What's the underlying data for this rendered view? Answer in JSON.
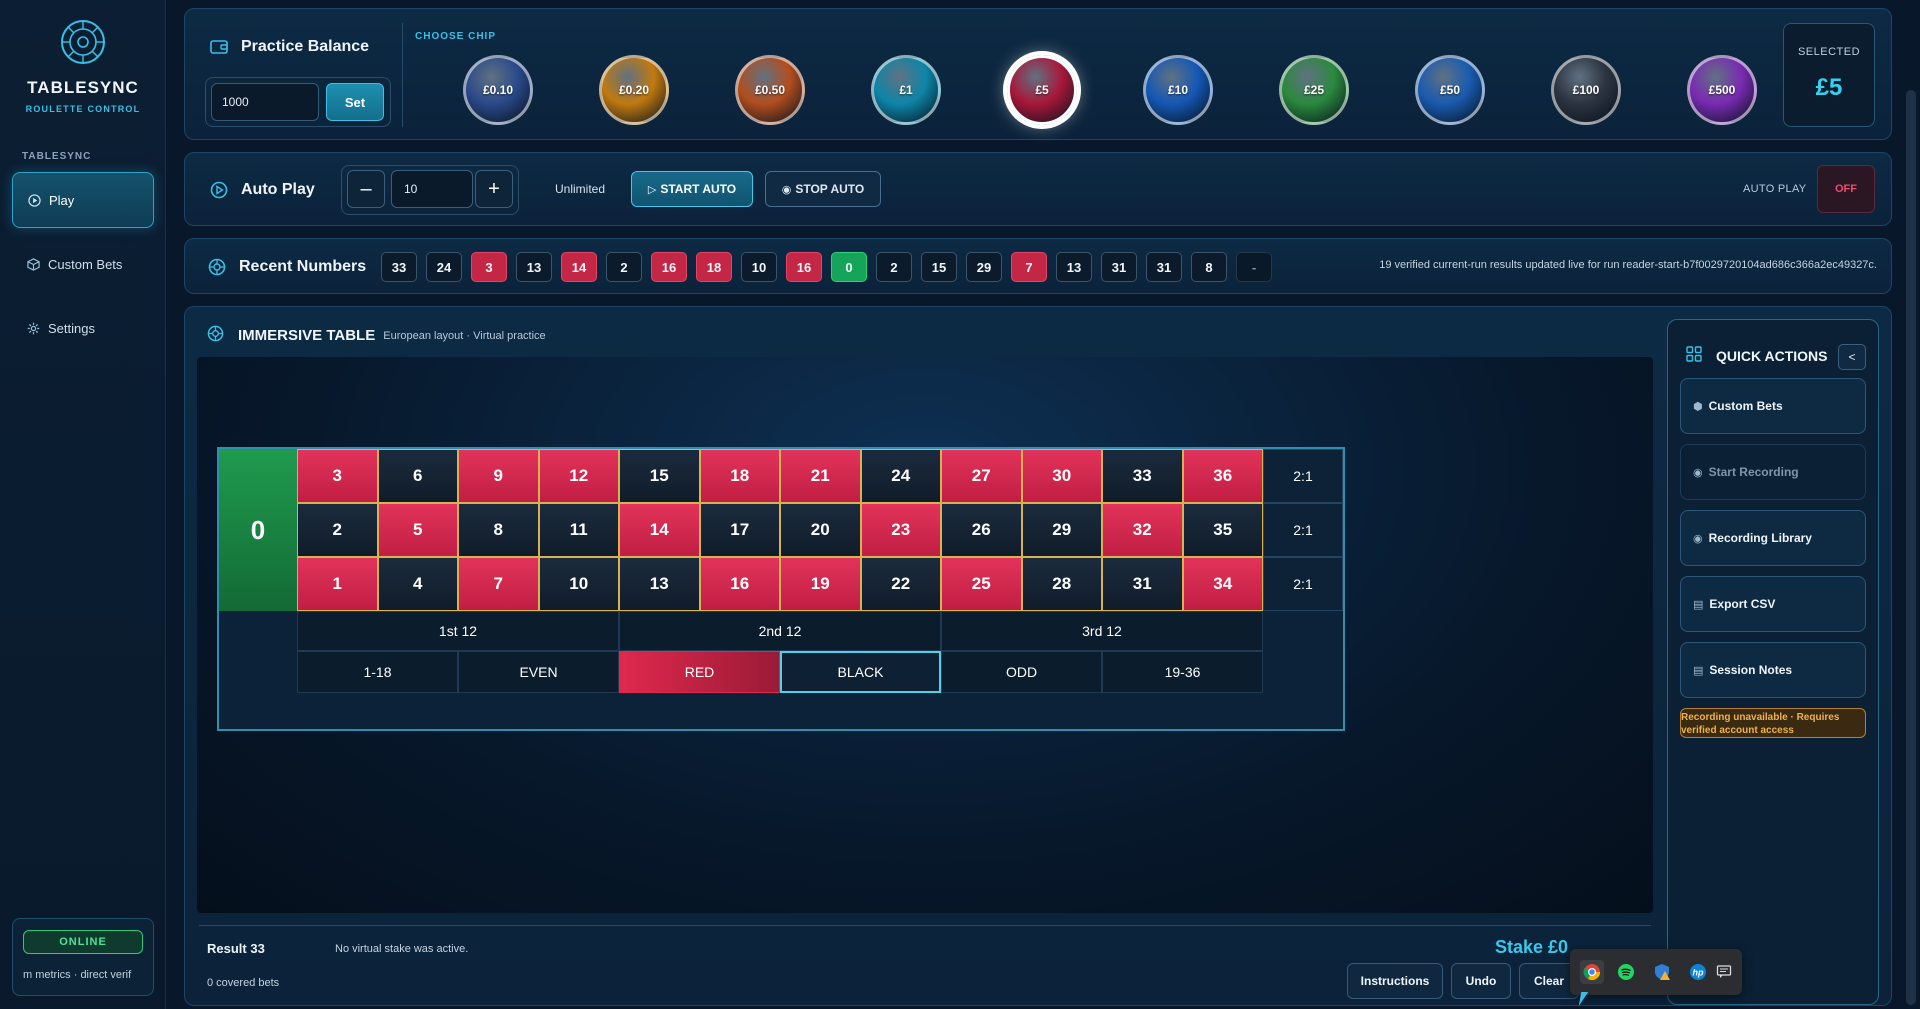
{
  "app": {
    "brand": "TABLESYNC",
    "brand_sub": "ROULETTE CONTROL"
  },
  "sidebar": {
    "section": "TABLESYNC",
    "items": [
      {
        "label": "Play",
        "icon": "play-circle-icon"
      },
      {
        "label": "Custom Bets",
        "icon": "cube-icon"
      },
      {
        "label": "Settings",
        "icon": "gear-icon"
      }
    ],
    "status": {
      "badge": "ONLINE",
      "text": "m metrics · direct verif"
    }
  },
  "balance": {
    "title": "Practice Balance",
    "input_value": "1000",
    "set_label": "Set",
    "choose_chip_label": "CHOOSE CHIP",
    "chips": [
      {
        "label": "£0.10",
        "color": "#2b4a8a"
      },
      {
        "label": "£0.20",
        "color": "#c27a10"
      },
      {
        "label": "£0.50",
        "color": "#b34e1f"
      },
      {
        "label": "£1",
        "color": "#0e86a8"
      },
      {
        "label": "£5",
        "color": "#a8173a"
      },
      {
        "label": "£10",
        "color": "#1558b5"
      },
      {
        "label": "£25",
        "color": "#2b8a3e"
      },
      {
        "label": "£50",
        "color": "#1a5bb0"
      },
      {
        "label": "£100",
        "color": "#2c3440"
      },
      {
        "label": "£500",
        "color": "#7a2bb3"
      }
    ],
    "selected_index": 4,
    "selected_label": "SELECTED",
    "selected_value": "£5"
  },
  "autoplay": {
    "title": "Auto Play",
    "minus": "–",
    "plus": "+",
    "spins_value": "10",
    "unlimited": "Unlimited",
    "start_label": "START AUTO",
    "stop_label": "STOP AUTO",
    "status_label": "AUTO PLAY",
    "status_value": "OFF"
  },
  "recent": {
    "title": "Recent Numbers",
    "numbers": [
      {
        "n": "33",
        "c": "black"
      },
      {
        "n": "24",
        "c": "black"
      },
      {
        "n": "3",
        "c": "red"
      },
      {
        "n": "13",
        "c": "black"
      },
      {
        "n": "14",
        "c": "red"
      },
      {
        "n": "2",
        "c": "black"
      },
      {
        "n": "16",
        "c": "red"
      },
      {
        "n": "18",
        "c": "red"
      },
      {
        "n": "10",
        "c": "black"
      },
      {
        "n": "16",
        "c": "red"
      },
      {
        "n": "0",
        "c": "green"
      },
      {
        "n": "2",
        "c": "black"
      },
      {
        "n": "15",
        "c": "black"
      },
      {
        "n": "29",
        "c": "black"
      },
      {
        "n": "7",
        "c": "red"
      },
      {
        "n": "13",
        "c": "black"
      },
      {
        "n": "31",
        "c": "black"
      },
      {
        "n": "31",
        "c": "black"
      },
      {
        "n": "8",
        "c": "black"
      },
      {
        "n": "-",
        "c": "blank"
      }
    ],
    "message": "19 verified current-run results updated live for run reader-start-b7f0029720104ad686c366a2ec49327c."
  },
  "table": {
    "title": "IMMERSIVE TABLE",
    "subtitle": "European layout · Virtual practice",
    "zero": "0",
    "rows": [
      [
        {
          "n": "3",
          "c": "red"
        },
        {
          "n": "6",
          "c": "black"
        },
        {
          "n": "9",
          "c": "red"
        },
        {
          "n": "12",
          "c": "red"
        },
        {
          "n": "15",
          "c": "black"
        },
        {
          "n": "18",
          "c": "red"
        },
        {
          "n": "21",
          "c": "red"
        },
        {
          "n": "24",
          "c": "black"
        },
        {
          "n": "27",
          "c": "red"
        },
        {
          "n": "30",
          "c": "red"
        },
        {
          "n": "33",
          "c": "black"
        },
        {
          "n": "36",
          "c": "red"
        }
      ],
      [
        {
          "n": "2",
          "c": "black"
        },
        {
          "n": "5",
          "c": "red"
        },
        {
          "n": "8",
          "c": "black"
        },
        {
          "n": "11",
          "c": "black"
        },
        {
          "n": "14",
          "c": "red"
        },
        {
          "n": "17",
          "c": "black"
        },
        {
          "n": "20",
          "c": "black"
        },
        {
          "n": "23",
          "c": "red"
        },
        {
          "n": "26",
          "c": "black"
        },
        {
          "n": "29",
          "c": "black"
        },
        {
          "n": "32",
          "c": "red"
        },
        {
          "n": "35",
          "c": "black"
        }
      ],
      [
        {
          "n": "1",
          "c": "red"
        },
        {
          "n": "4",
          "c": "black"
        },
        {
          "n": "7",
          "c": "red"
        },
        {
          "n": "10",
          "c": "black"
        },
        {
          "n": "13",
          "c": "black"
        },
        {
          "n": "16",
          "c": "red"
        },
        {
          "n": "19",
          "c": "red"
        },
        {
          "n": "22",
          "c": "black"
        },
        {
          "n": "25",
          "c": "red"
        },
        {
          "n": "28",
          "c": "black"
        },
        {
          "n": "31",
          "c": "black"
        },
        {
          "n": "34",
          "c": "red"
        }
      ]
    ],
    "columns": [
      "2:1",
      "2:1",
      "2:1"
    ],
    "dozens": [
      "1st 12",
      "2nd 12",
      "3rd 12"
    ],
    "outside": [
      "1-18",
      "EVEN",
      "RED",
      "BLACK",
      "ODD",
      "19-36"
    ],
    "result": "Result 33",
    "result_msg": "No virtual stake was active.",
    "covered": "0 covered bets",
    "stake": "Stake £0",
    "buttons": [
      "Instructions",
      "Undo",
      "Clear"
    ]
  },
  "quick_actions": {
    "title": "QUICK ACTIONS",
    "collapse": "<",
    "items": [
      {
        "label": "Custom Bets",
        "disabled": false
      },
      {
        "label": "Start Recording",
        "disabled": true
      },
      {
        "label": "Recording Library",
        "disabled": false
      },
      {
        "label": "Export CSV",
        "disabled": false
      },
      {
        "label": "Session Notes",
        "disabled": false
      }
    ],
    "warning": "Recording unavailable · Requires verified account access"
  },
  "tray": {
    "icons": [
      "chrome-icon",
      "spotify-icon",
      "vpn-shield-icon",
      "hp-icon",
      "chat-icon"
    ]
  }
}
